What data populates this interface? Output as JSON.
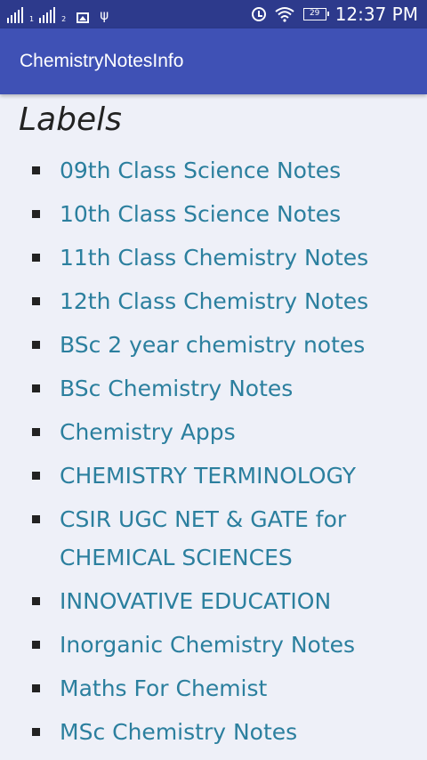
{
  "status_bar": {
    "time": "12:37 PM",
    "battery_level": "29",
    "sim1_label": "1",
    "sim2_label": "2",
    "icons": [
      "signal-icon",
      "signal-icon",
      "image-icon",
      "usb-icon",
      "alarm-icon",
      "wifi-icon",
      "battery-icon"
    ]
  },
  "app_bar": {
    "title": "ChemistryNotesInfo",
    "color": "#3f51b5"
  },
  "labels_section": {
    "title": "Labels",
    "items": [
      {
        "label": "09th Class Science Notes"
      },
      {
        "label": "10th Class Science Notes"
      },
      {
        "label": "11th Class Chemistry Notes"
      },
      {
        "label": "12th Class Chemistry Notes"
      },
      {
        "label": "BSc 2 year chemistry notes"
      },
      {
        "label": "BSc Chemistry Notes"
      },
      {
        "label": "Chemistry Apps"
      },
      {
        "label": "CHEMISTRY TERMINOLOGY"
      },
      {
        "label": "CSIR UGC NET & GATE for CHEMICAL SCIENCES"
      },
      {
        "label": "INNOVATIVE EDUCATION"
      },
      {
        "label": "Inorganic Chemistry Notes"
      },
      {
        "label": "Maths For Chemist"
      },
      {
        "label": "MSc Chemistry Notes"
      }
    ],
    "link_color": "#2b7f9e"
  }
}
